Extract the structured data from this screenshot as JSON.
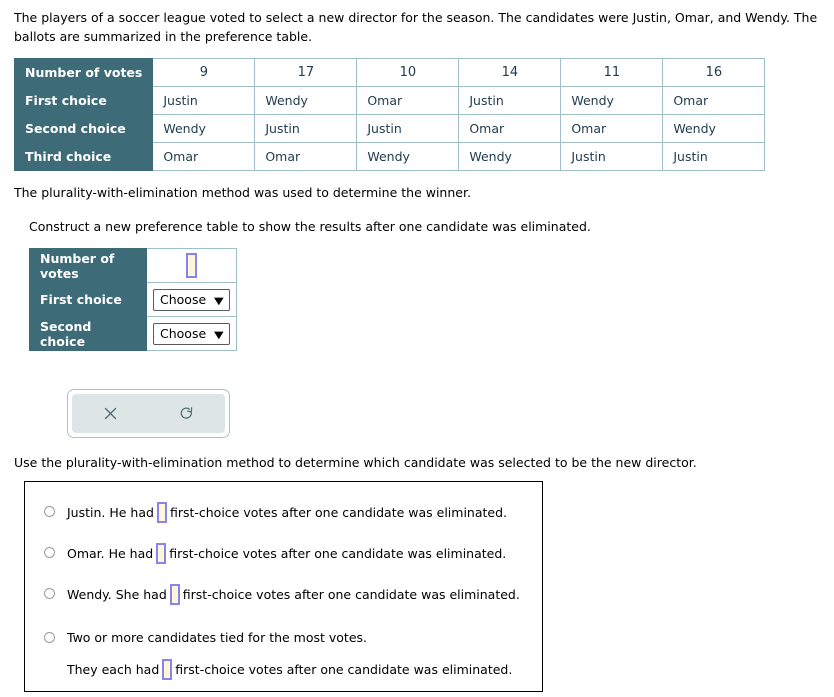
{
  "intro": "The players of a soccer league voted to select a new director for the season. The candidates were Justin, Omar, and Wendy. The ballots are summarized in the preference table.",
  "statements": {
    "method": "The plurality-with-elimination method was used to determine the winner.",
    "construct": "Construct a new preference table to show the results after one candidate was eliminated.",
    "use_method": "Use the plurality-with-elimination method to determine which candidate was selected to be the new director."
  },
  "preference_table": {
    "row_headers": [
      "Number of votes",
      "First choice",
      "Second choice",
      "Third choice"
    ],
    "votes": [
      "9",
      "17",
      "10",
      "14",
      "11",
      "16"
    ],
    "first_choice": [
      "Justin",
      "Wendy",
      "Omar",
      "Justin",
      "Wendy",
      "Omar"
    ],
    "second_choice": [
      "Wendy",
      "Justin",
      "Justin",
      "Omar",
      "Omar",
      "Wendy"
    ],
    "third_choice": [
      "Omar",
      "Omar",
      "Wendy",
      "Wendy",
      "Justin",
      "Justin"
    ]
  },
  "answer_table": {
    "row_headers": [
      "Number of votes",
      "First choice",
      "Second choice"
    ],
    "votes_value": "",
    "first_choice_select": "Choose",
    "second_choice_select": "Choose",
    "caret": "▼"
  },
  "toolbar": {
    "clear_icon": "close-icon",
    "undo_icon": "undo-icon"
  },
  "multiple_choice": {
    "options": [
      {
        "prefix": "Justin. He had",
        "suffix": "first-choice votes after one candidate was eliminated.",
        "value": ""
      },
      {
        "prefix": "Omar. He had",
        "suffix": "first-choice votes after one candidate was eliminated.",
        "value": ""
      },
      {
        "prefix": "Wendy. She had",
        "suffix": "first-choice votes after one candidate was eliminated.",
        "value": ""
      },
      {
        "prefix": "Two or more candidates tied for the most votes.",
        "suffix": "",
        "value": ""
      }
    ],
    "tie_line": {
      "prefix": "They each had",
      "suffix": "first-choice votes after one candidate was eliminated.",
      "value": ""
    }
  },
  "colors": {
    "header_bg": "#3e6b78",
    "table_border": "#9fc0c8",
    "cell_text": "#1f3a4d",
    "input_border": "#8b84e8",
    "input_bg": "#fdf6d8",
    "toolbar_bg": "#dde5e7",
    "toolbar_icon": "#4a6b74"
  }
}
